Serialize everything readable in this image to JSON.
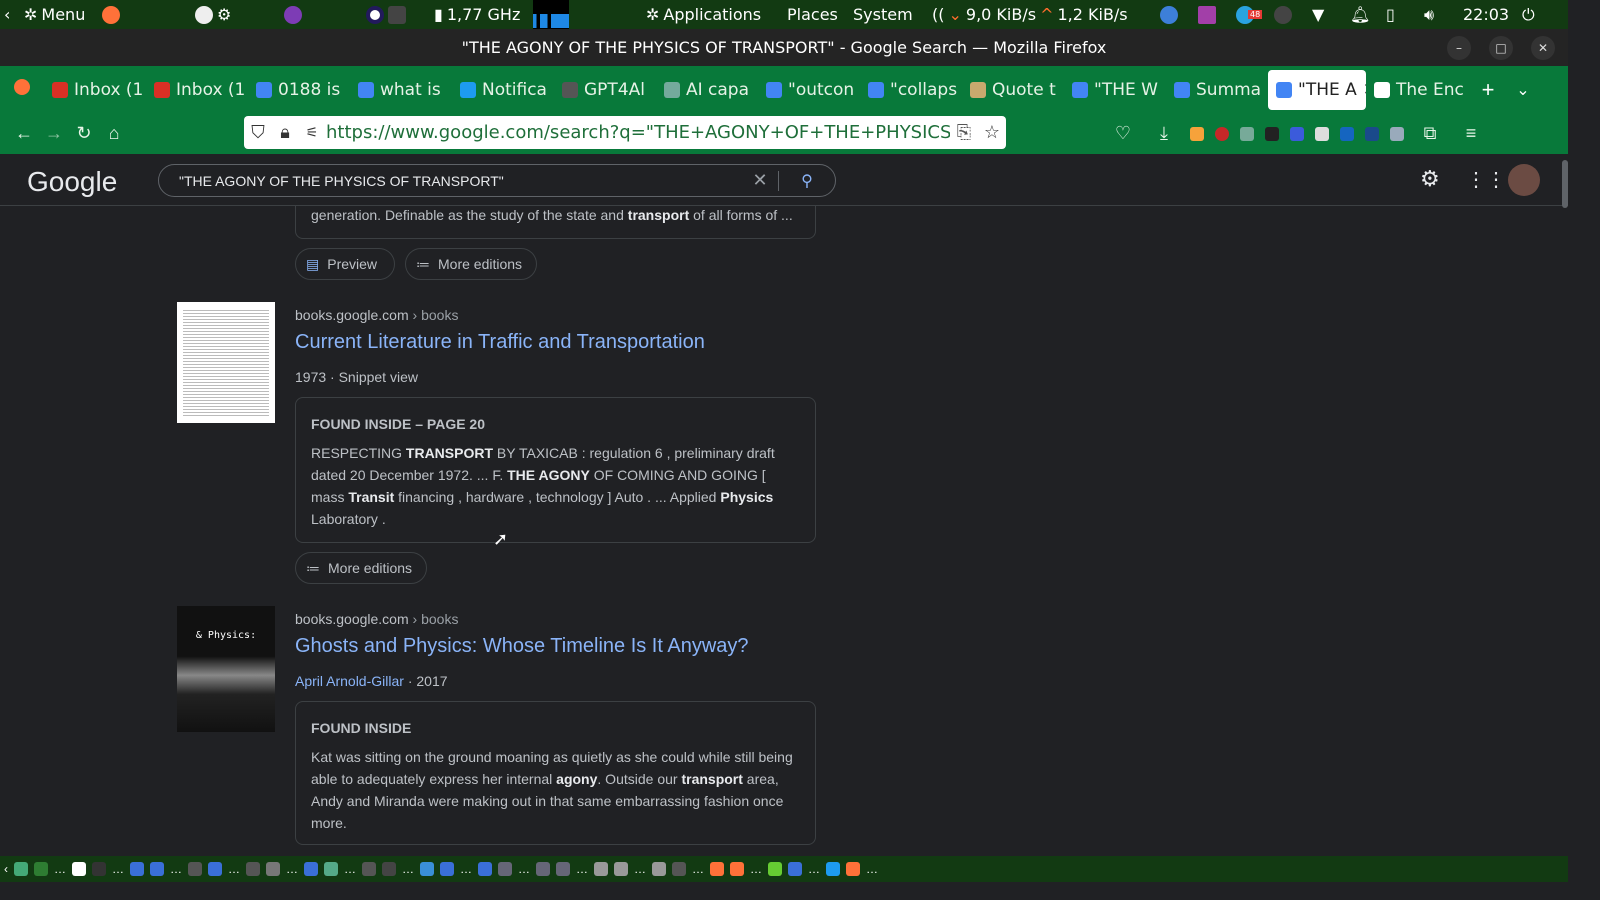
{
  "panel": {
    "menu": "Menu",
    "cpu": "1,77 GHz",
    "applications": "Applications",
    "places": "Places",
    "system": "System",
    "net_down": "9,0 KiB/s",
    "net_up": "1,2 KiB/s",
    "clock": "22:03",
    "telegram_badge": "48"
  },
  "window": {
    "title": "\"THE AGONY OF THE PHYSICS OF TRANSPORT\" - Google Search — Mozilla Firefox"
  },
  "tabs": [
    {
      "label": "Inbox (1",
      "icon": "gmail-icon",
      "color": "#d93025"
    },
    {
      "label": "Inbox (1",
      "icon": "gmail-icon",
      "color": "#d93025"
    },
    {
      "label": "0188 is",
      "icon": "gmail-icon",
      "color": "#4285f4"
    },
    {
      "label": "what is",
      "icon": "google-icon",
      "color": "#4285f4"
    },
    {
      "label": "Notifica",
      "icon": "twitter-icon",
      "color": "#1d9bf0"
    },
    {
      "label": "GPT4Al",
      "icon": "gpt4all-icon",
      "color": "#555"
    },
    {
      "label": "AI capa",
      "icon": "openai-icon",
      "color": "#74aa9c"
    },
    {
      "label": "\"outcon",
      "icon": "google-icon",
      "color": "#4285f4"
    },
    {
      "label": "\"collaps",
      "icon": "google-icon",
      "color": "#4285f4"
    },
    {
      "label": "Quote t",
      "icon": "goodreads-icon",
      "color": "#c8a96e"
    },
    {
      "label": "\"THE W",
      "icon": "google-icon",
      "color": "#4285f4"
    },
    {
      "label": "Summa",
      "icon": "google-icon",
      "color": "#4285f4"
    },
    {
      "label": "\"THE A",
      "icon": "google-icon",
      "color": "#4285f4",
      "active": true
    },
    {
      "label": "The Enc",
      "icon": "wikipedia-icon",
      "color": "#fff"
    }
  ],
  "url": "https://www.google.com/search?q=\"THE+AGONY+OF+THE+PHYSICS+OF",
  "google": {
    "logo": "Google",
    "query": "\"THE AGONY OF THE PHYSICS OF TRANSPORT\""
  },
  "results": {
    "prev_snippet": [
      {
        "t": "generation. Definable as the study of the state and "
      },
      {
        "t": "transport",
        "b": true
      },
      {
        "t": " of all forms of ..."
      }
    ],
    "prev_buttons": {
      "preview": "Preview",
      "more_editions": "More editions"
    },
    "r1": {
      "site": "books.google.com",
      "path": "› books",
      "title": "Current Literature in Traffic and Transportation",
      "meta": "1973 · Snippet view",
      "label": "FOUND INSIDE – PAGE 20",
      "snippet": [
        {
          "t": "RESPECTING "
        },
        {
          "t": "TRANSPORT",
          "b": true
        },
        {
          "t": " BY TAXICAB : regulation 6 , preliminary draft dated 20 December 1972. ... F. "
        },
        {
          "t": "THE AGONY",
          "b": true
        },
        {
          "t": " OF COMING AND GOING [ mass "
        },
        {
          "t": "Transit",
          "b": true
        },
        {
          "t": " financing , hardware , technology ] Auto . ... Applied "
        },
        {
          "t": "Physics",
          "b": true
        },
        {
          "t": " Laboratory ."
        }
      ],
      "more_editions": "More editions"
    },
    "r2": {
      "site": "books.google.com",
      "path": "› books",
      "title": "Ghosts and Physics: Whose Timeline Is It Anyway?",
      "author": "April Arnold-Gillar",
      "year": " · 2017",
      "label": "FOUND INSIDE",
      "cover_text": "& Physics:",
      "snippet": [
        {
          "t": "Kat was sitting on the ground moaning as quietly as she could while still being able to adequately express her internal "
        },
        {
          "t": "agony",
          "b": true
        },
        {
          "t": ". Outside our "
        },
        {
          "t": "transport",
          "b": true
        },
        {
          "t": " area, Andy and Miranda were making out in that same embarrassing fashion once more."
        }
      ]
    }
  },
  "taskbar": {
    "ellipsis": "…"
  }
}
